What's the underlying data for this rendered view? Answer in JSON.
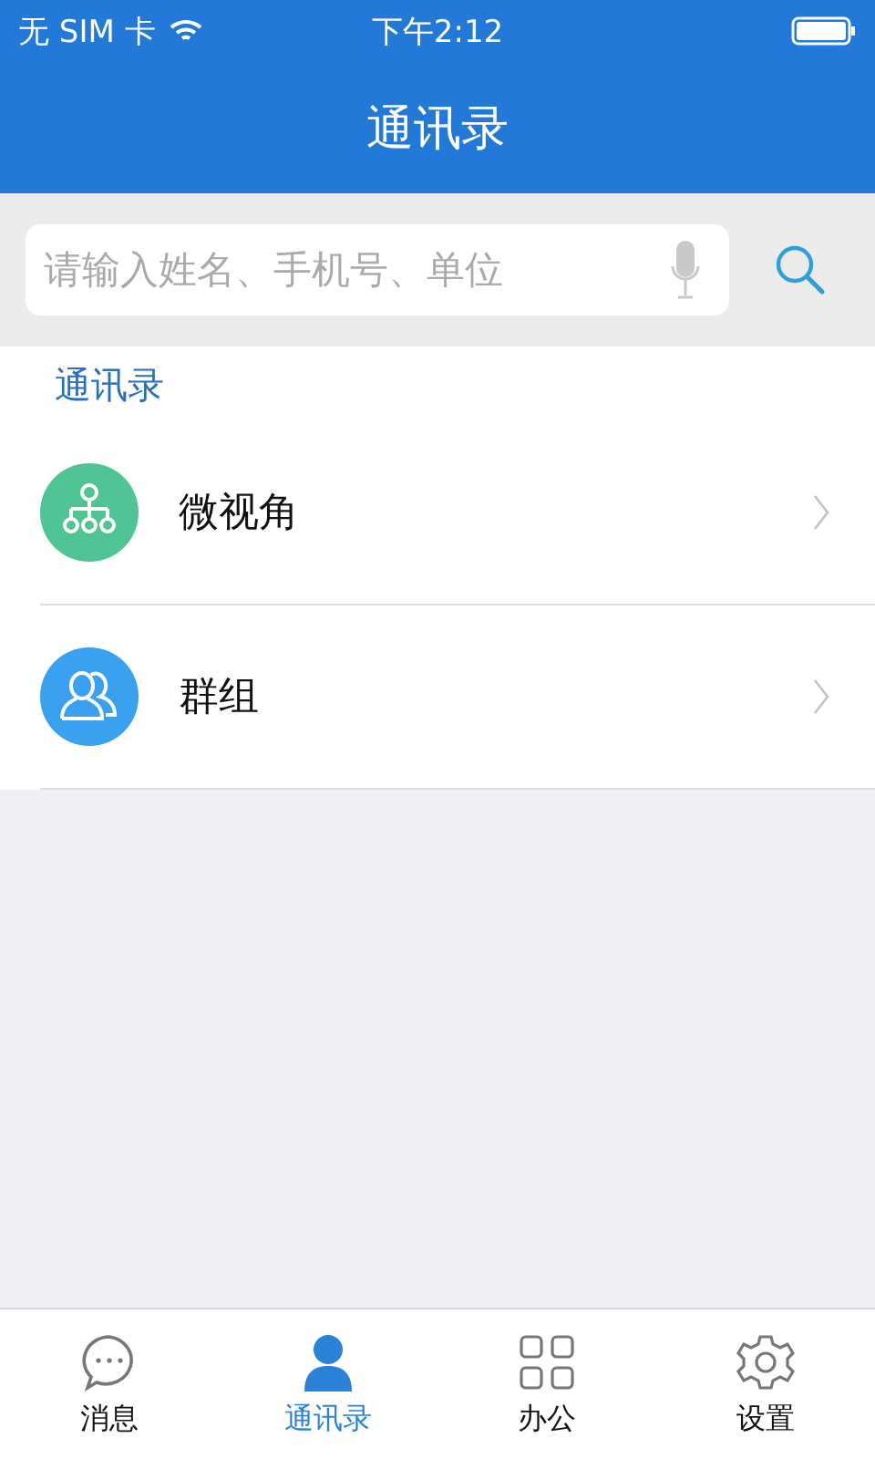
{
  "status_bar": {
    "carrier": "无 SIM 卡",
    "time": "下午2:12"
  },
  "nav": {
    "title": "通讯录"
  },
  "search": {
    "placeholder": "请输入姓名、手机号、单位"
  },
  "section": {
    "title": "通讯录"
  },
  "rows": [
    {
      "label": "微视角",
      "kind": "org",
      "color": "#4fc495"
    },
    {
      "label": "群组",
      "kind": "group",
      "color": "#3aa0f0"
    }
  ],
  "tabs": [
    {
      "label": "消息",
      "kind": "chat",
      "selected": false
    },
    {
      "label": "通讯录",
      "kind": "contacts",
      "selected": true
    },
    {
      "label": "办公",
      "kind": "grid",
      "selected": false
    },
    {
      "label": "设置",
      "kind": "gear",
      "selected": false
    }
  ]
}
